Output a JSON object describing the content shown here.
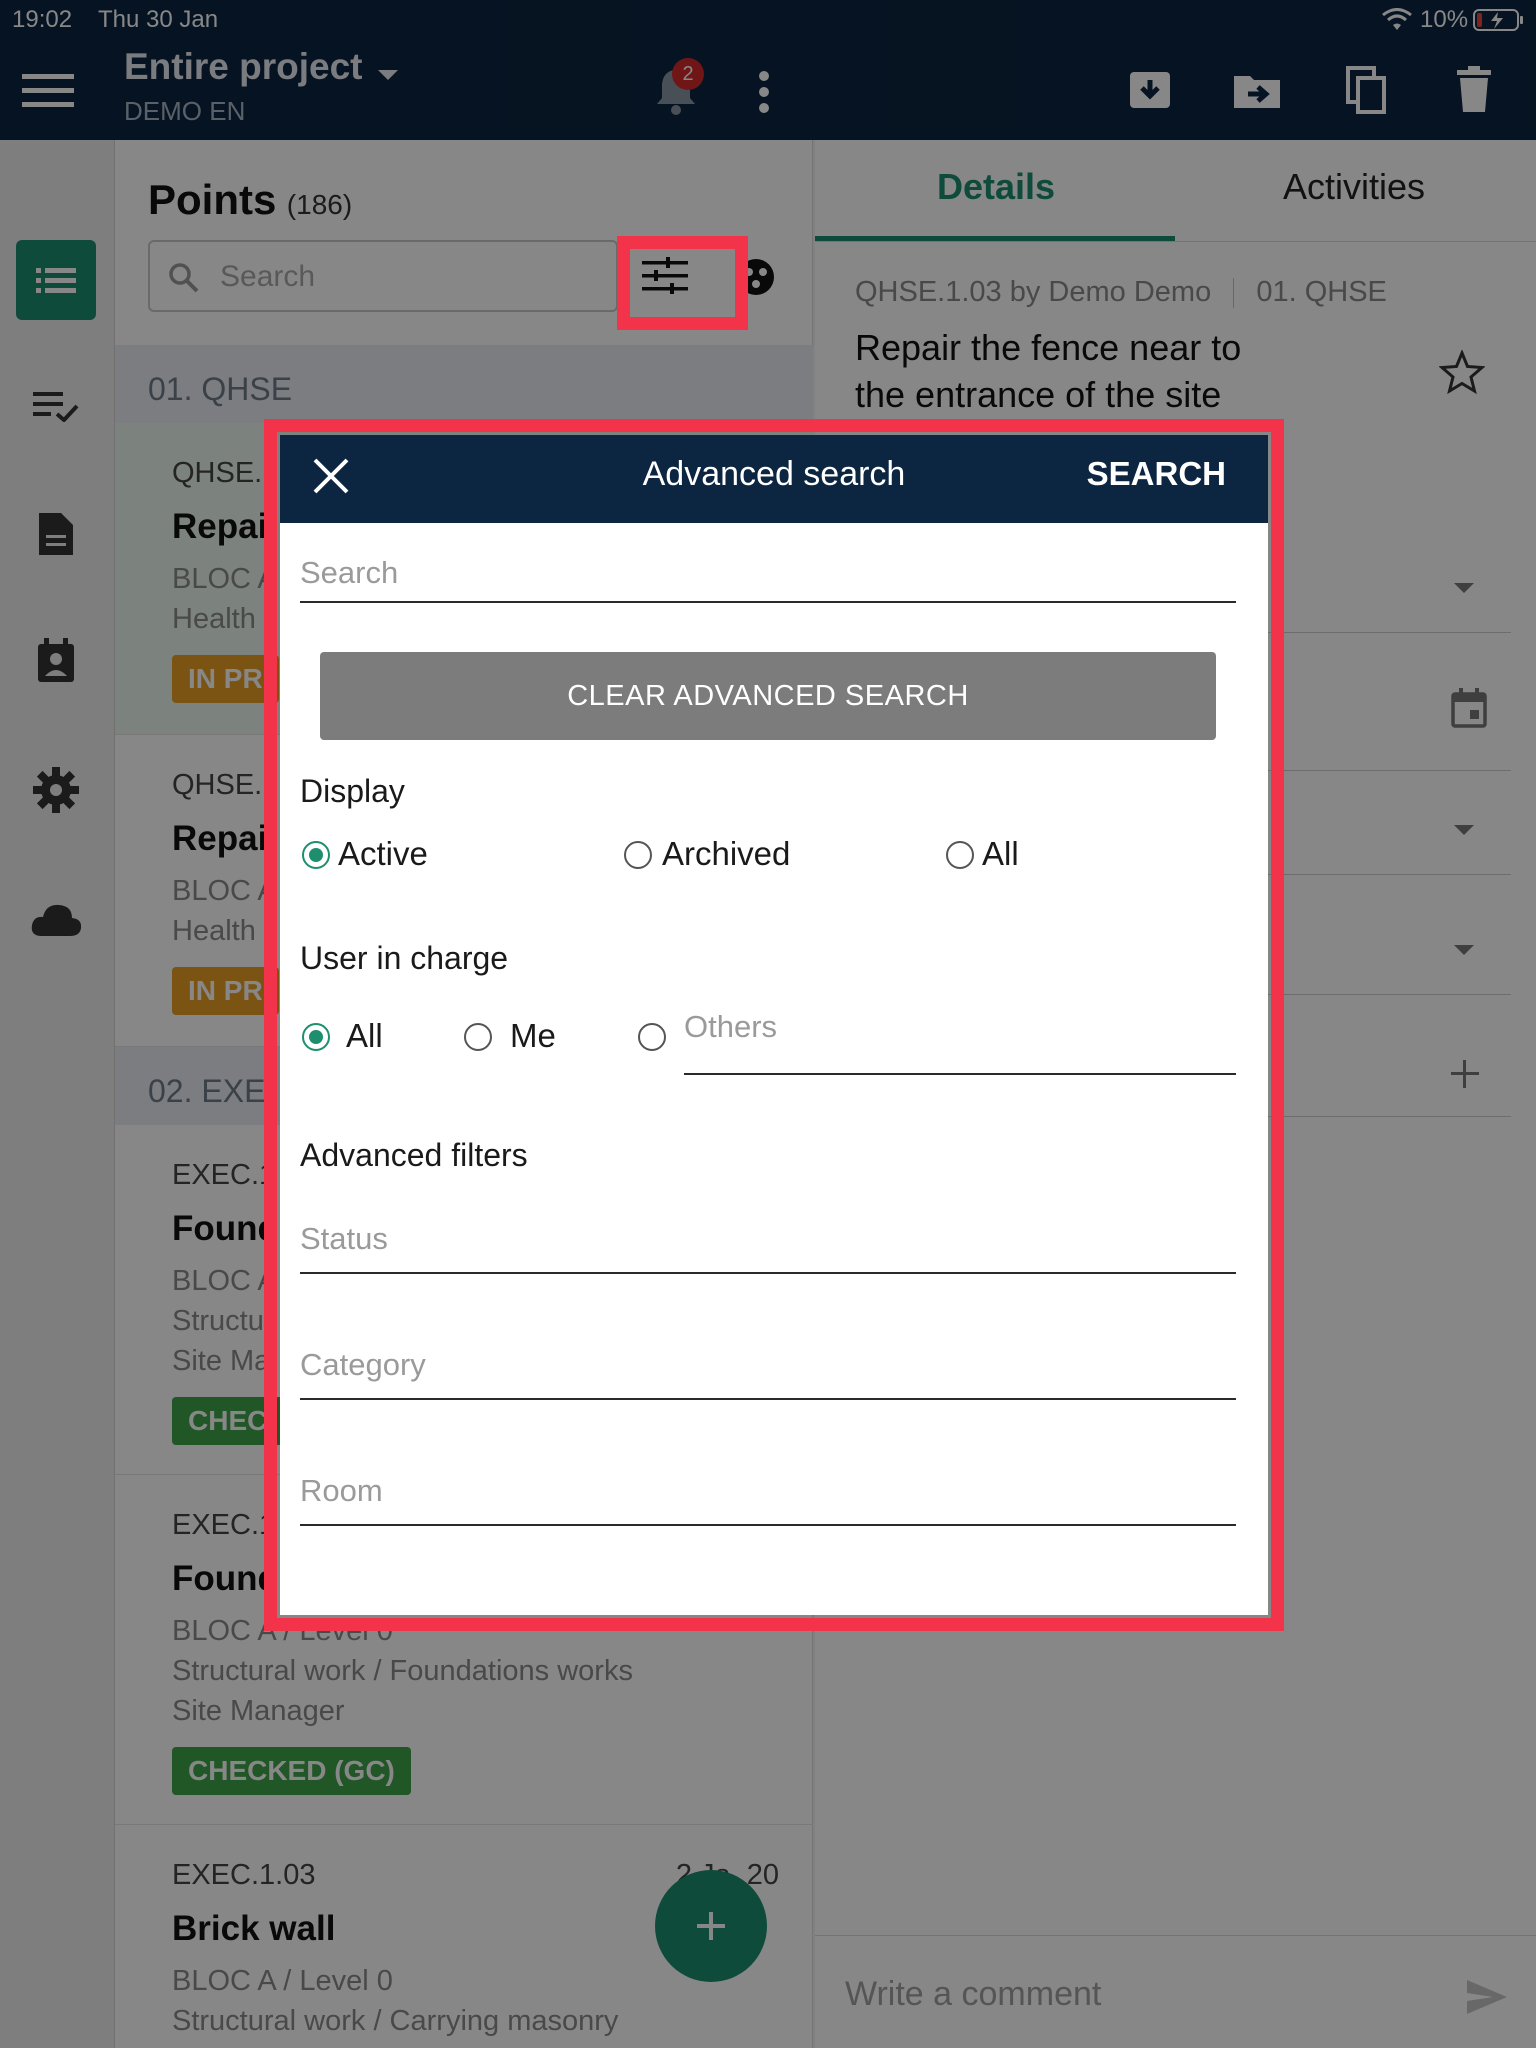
{
  "status_bar": {
    "time": "19:02",
    "date": "Thu 30 Jan",
    "battery": "10%"
  },
  "header": {
    "title": "Entire project",
    "subtitle": "DEMO EN",
    "notification_count": "2"
  },
  "list": {
    "title": "Points",
    "count": "(186)",
    "search_placeholder": "Search",
    "sections": [
      {
        "title": "01. QHSE"
      },
      {
        "title": "02. EXE"
      }
    ],
    "items": [
      {
        "code": "QHSE.1",
        "title": "Repai",
        "location": "BLOC A",
        "trade": "Health",
        "badge": "IN PR"
      },
      {
        "code": "QHSE.1",
        "title": "Repai",
        "location": "BLOC A",
        "trade": "Health",
        "badge": "IN PR"
      },
      {
        "code": "EXEC.1",
        "title": "Found",
        "location": "BLOC A",
        "trade": "Structu",
        "role": "Site Ma",
        "badge": "CHEC"
      },
      {
        "code": "EXEC.1",
        "title": "Found",
        "location": "BLOC A / Level 0",
        "trade": "Structural work / Foundations works",
        "role": "Site Manager",
        "badge": "CHECKED (GC)"
      },
      {
        "code": "EXEC.1.03",
        "date": "2 Ja  20",
        "title": "Brick wall",
        "location": "BLOC A / Level 0",
        "trade": "Structural work / Carrying masonry"
      }
    ]
  },
  "detail": {
    "tabs": [
      {
        "label": "Details"
      },
      {
        "label": "Activities"
      }
    ],
    "meta": "QHSE.1.03 by Demo Demo",
    "category": "01. QHSE",
    "title_line1": "Repair the fence near to",
    "title_line2": "the entrance of the site",
    "comment_placeholder": "Write a comment"
  },
  "modal": {
    "title": "Advanced search",
    "search_action": "SEARCH",
    "search_placeholder": "Search",
    "clear_button": "CLEAR ADVANCED SEARCH",
    "display": {
      "label": "Display",
      "options": [
        {
          "label": "Active",
          "selected": true
        },
        {
          "label": "Archived",
          "selected": false
        },
        {
          "label": "All",
          "selected": false
        }
      ]
    },
    "user_in_charge": {
      "label": "User in charge",
      "options": [
        {
          "label": "All",
          "selected": true
        },
        {
          "label": "Me",
          "selected": false
        }
      ],
      "others_placeholder": "Others"
    },
    "advanced_filters": {
      "label": "Advanced filters",
      "status_placeholder": "Status",
      "category_placeholder": "Category",
      "room_placeholder": "Room"
    }
  },
  "colors": {
    "brand_dark": "#0c2540",
    "accent_green": "#1e8f6e",
    "highlight_red": "#f2334a"
  }
}
